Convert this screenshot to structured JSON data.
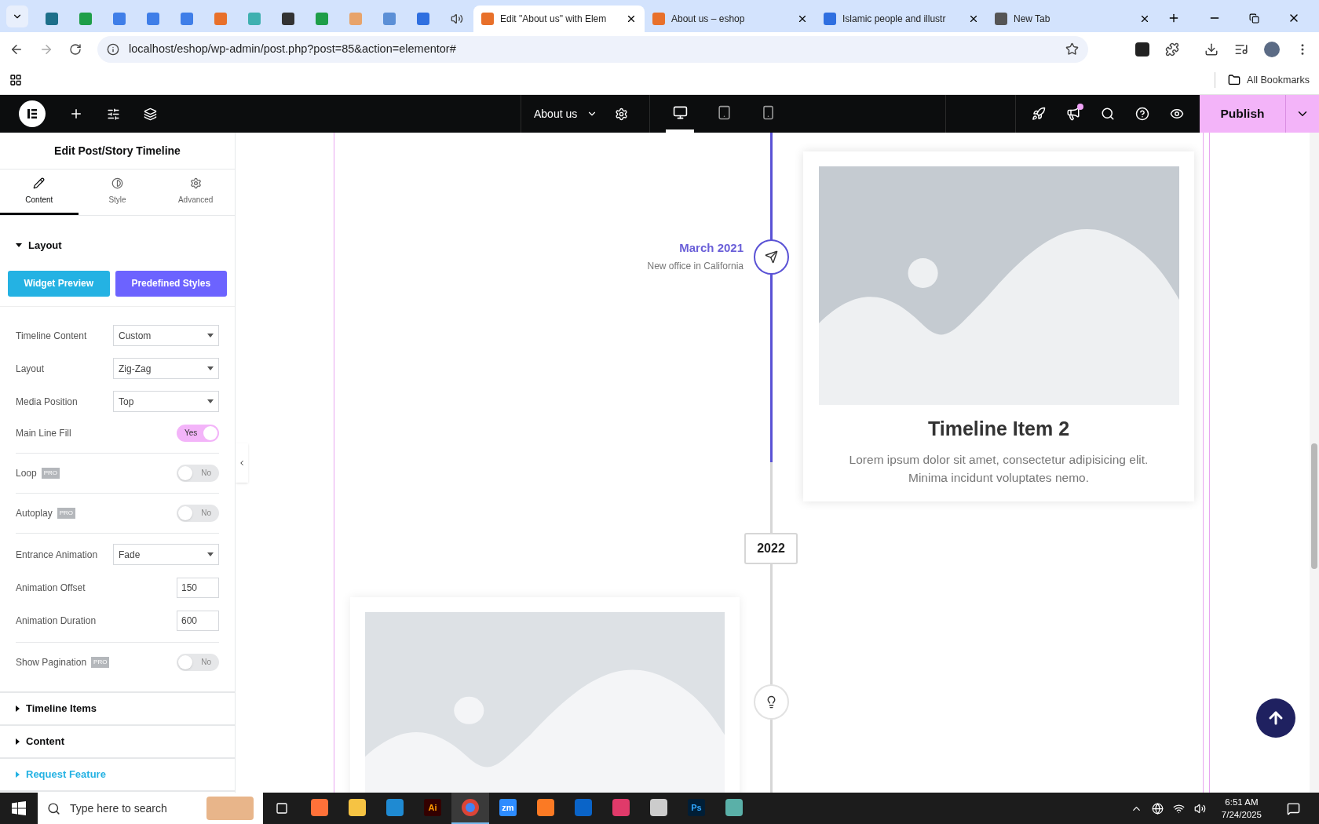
{
  "browser": {
    "tabs": [
      {
        "kind": "pinned",
        "color": "#1d6f8a",
        "selected": false
      },
      {
        "kind": "pinned",
        "color": "#1e9e48",
        "selected": false
      },
      {
        "kind": "pinned",
        "color": "#3f7ee8",
        "selected": false
      },
      {
        "kind": "pinned",
        "color": "#3f7ee8",
        "selected": false
      },
      {
        "kind": "pinned",
        "color": "#3f7ee8",
        "selected": false
      },
      {
        "kind": "pinned",
        "color": "#e8702a",
        "selected": false
      },
      {
        "kind": "pinned",
        "color": "#3fb0b0",
        "selected": false
      },
      {
        "kind": "pinned",
        "color": "#333333",
        "selected": false
      },
      {
        "kind": "pinned",
        "color": "#1e9e48",
        "selected": false
      },
      {
        "kind": "pinned",
        "color": "#e8a36a",
        "selected": false
      },
      {
        "kind": "pinned",
        "color": "#5b8fd6",
        "selected": false
      },
      {
        "kind": "pinned",
        "color": "#2f6fe0",
        "selected": false
      },
      {
        "kind": "audio",
        "color": "#444444",
        "selected": false
      },
      {
        "kind": "page",
        "color": "#e8702a",
        "label": "Edit \"About us\" with Elem",
        "selected": true
      },
      {
        "kind": "page",
        "color": "#e8702a",
        "label": "About us – eshop",
        "selected": false
      },
      {
        "kind": "page",
        "color": "#2f6fe0",
        "label": "Islamic people and illustr",
        "selected": false
      },
      {
        "kind": "page",
        "color": "#555555",
        "label": "New Tab",
        "selected": false
      }
    ],
    "address": "localhost/eshop/wp-admin/post.php?post=85&action=elementor#",
    "bookmarks": "All Bookmarks"
  },
  "editor_bar": {
    "page": "About us",
    "devices": [
      {
        "kind": "desktop",
        "selected": true
      },
      {
        "kind": "tablet",
        "selected": false
      },
      {
        "kind": "mobile",
        "selected": false
      }
    ],
    "notification": true,
    "publish": "Publish"
  },
  "panel": {
    "title": "Edit Post/Story Timeline",
    "tabs": [
      {
        "label": "Content",
        "kind": "content",
        "selected": true
      },
      {
        "label": "Style",
        "kind": "style",
        "selected": false
      },
      {
        "label": "Advanced",
        "kind": "advanced",
        "selected": false
      }
    ],
    "section": {
      "title": "Layout",
      "expanded": true
    },
    "buttons": [
      "Widget Preview",
      "Predefined Styles"
    ],
    "groups": [
      [
        {
          "kind": "select",
          "label": "Timeline Content",
          "value": "Custom"
        },
        {
          "kind": "select",
          "label": "Layout",
          "value": "Zig-Zag"
        },
        {
          "kind": "select",
          "label": "Media Position",
          "value": "Top"
        },
        {
          "kind": "toggle",
          "label": "Main Line Fill",
          "on": true,
          "text": "Yes"
        }
      ],
      [
        {
          "kind": "toggle",
          "label": "Loop",
          "badge": "PRO",
          "on": false,
          "text": "No"
        }
      ],
      [
        {
          "kind": "toggle",
          "label": "Autoplay",
          "badge": "PRO",
          "on": false,
          "text": "No"
        }
      ],
      [
        {
          "kind": "select",
          "label": "Entrance Animation",
          "value": "Fade"
        },
        {
          "kind": "number",
          "label": "Animation Offset",
          "value": "150"
        },
        {
          "kind": "number",
          "label": "Animation Duration",
          "value": "600"
        }
      ],
      [
        {
          "kind": "toggle",
          "label": "Show Pagination",
          "badge": "PRO",
          "on": false,
          "text": "No"
        }
      ]
    ],
    "sections": [
      {
        "title": "Timeline Items",
        "kind": "section"
      },
      {
        "title": "Content",
        "kind": "section"
      },
      {
        "title": "Request Feature",
        "kind": "link"
      }
    ]
  },
  "canvas": {
    "date": "March 2021",
    "subtitle": "New office in California",
    "card": {
      "title": "Timeline Item 2",
      "text": "Lorem ipsum dolor sit amet, consectetur adipisicing elit. Minima incidunt voluptates nemo."
    },
    "year": "2022"
  },
  "taskbar": {
    "search_placeholder": "Type here to search",
    "apps": [
      {
        "kind": "firefox",
        "color": "#ff7139"
      },
      {
        "kind": "folder",
        "color": "#f6c343"
      },
      {
        "kind": "code",
        "color": "#1f8ad2"
      },
      {
        "kind": "text",
        "label": {
          "text": "Ai",
          "color": "#ff9a00"
        },
        "color": "#330000"
      },
      {
        "kind": "chrome",
        "color": "#4285f4",
        "selected": true
      },
      {
        "kind": "text",
        "label": {
          "text": "zm"
        },
        "color": "#2d8cff"
      },
      {
        "kind": "xampp",
        "color": "#fb7a24"
      },
      {
        "kind": "outlook",
        "color": "#0a64c8"
      },
      {
        "kind": "cloud",
        "color": "#e03a6a"
      },
      {
        "kind": "pen",
        "color": "#cccccc"
      },
      {
        "kind": "text",
        "label": {
          "text": "Ps",
          "color": "#31a8ff"
        },
        "color": "#001e36"
      },
      {
        "kind": "gem",
        "color": "#5ab0a8"
      }
    ],
    "time": "6:51 AM",
    "date": "7/24/2025"
  }
}
